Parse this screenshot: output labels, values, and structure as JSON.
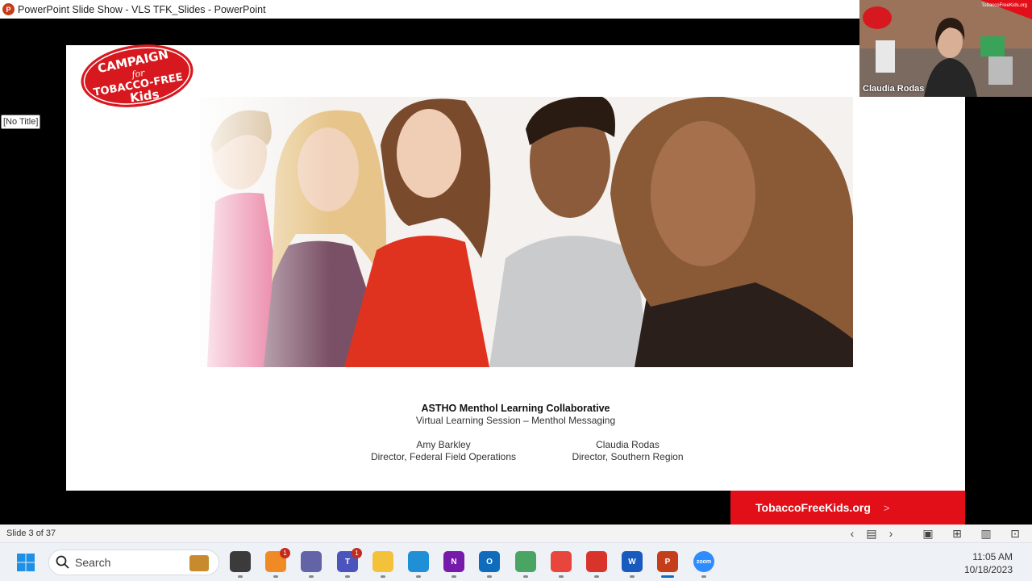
{
  "window": {
    "title": "PowerPoint Slide Show  -  VLS TFK_Slides - PowerPoint"
  },
  "slide": {
    "logo_text": [
      "CAMPAIGN",
      "for",
      "TOBACCO-FREE",
      "Kids"
    ],
    "title": "ASTHO Menthol Learning Collaborative",
    "subtitle": "Virtual Learning Session – Menthol Messaging",
    "presenters": [
      {
        "name": "Amy Barkley",
        "role": "Director, Federal Field Operations"
      },
      {
        "name": "Claudia Rodas",
        "role": "Director, Southern Region"
      }
    ],
    "footer_link": "TobaccoFreeKids.org",
    "footer_chevron": ">"
  },
  "no_title_label": "[No Title]",
  "video": {
    "participant_name": "Claudia Rodas",
    "site_text": "TobaccoFreeKids.org"
  },
  "statusbar": {
    "slide_counter": "Slide 3 of 37"
  },
  "taskbar": {
    "search_placeholder": "Search",
    "apps": [
      {
        "name": "file-explorer-task",
        "color": "#3b3b3b",
        "label": "",
        "badge": ""
      },
      {
        "name": "orange-app",
        "color": "#f08a24",
        "label": "",
        "badge": "1"
      },
      {
        "name": "teams-chat",
        "color": "#6264a7",
        "label": "",
        "badge": ""
      },
      {
        "name": "teams",
        "color": "#4b53bc",
        "label": "T",
        "badge": "1"
      },
      {
        "name": "file-explorer",
        "color": "#f3c13a",
        "label": "",
        "badge": ""
      },
      {
        "name": "edge",
        "color": "#1f8fd6",
        "label": "",
        "badge": ""
      },
      {
        "name": "onenote",
        "color": "#7719aa",
        "label": "N",
        "badge": ""
      },
      {
        "name": "outlook",
        "color": "#0f6cbd",
        "label": "O",
        "badge": ""
      },
      {
        "name": "maps",
        "color": "#4aa564",
        "label": "",
        "badge": ""
      },
      {
        "name": "chrome",
        "color": "#e8453c",
        "label": "",
        "badge": ""
      },
      {
        "name": "acrobat",
        "color": "#d9342b",
        "label": "",
        "badge": ""
      },
      {
        "name": "word",
        "color": "#185abd",
        "label": "W",
        "badge": ""
      },
      {
        "name": "powerpoint",
        "color": "#c43e1c",
        "label": "P",
        "badge": ""
      },
      {
        "name": "zoom",
        "color": "#2d8cff",
        "label": "zoom",
        "badge": ""
      }
    ],
    "time": "11:05 AM",
    "date": "10/18/2023"
  }
}
